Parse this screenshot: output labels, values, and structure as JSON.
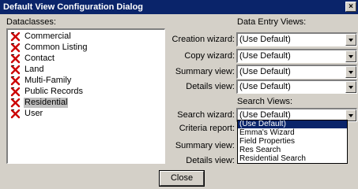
{
  "window": {
    "title": "Default View Configuration Dialog",
    "close_glyph": "×"
  },
  "dataclasses": {
    "label": "Dataclasses:",
    "items": [
      {
        "label": "Commercial",
        "selected": false
      },
      {
        "label": "Common Listing",
        "selected": false
      },
      {
        "label": "Contact",
        "selected": false
      },
      {
        "label": "Land",
        "selected": false
      },
      {
        "label": "Multi-Family",
        "selected": false
      },
      {
        "label": "Public Records",
        "selected": false
      },
      {
        "label": "Residential",
        "selected": true
      },
      {
        "label": "User",
        "selected": false
      }
    ],
    "icon": "red-x-icon"
  },
  "data_entry_views": {
    "heading": "Data Entry Views:",
    "creation_wizard": {
      "label": "Creation wizard:",
      "value": "(Use Default)"
    },
    "copy_wizard": {
      "label": "Copy wizard:",
      "value": "(Use Default)"
    },
    "summary_view": {
      "label": "Summary view:",
      "value": "(Use Default)"
    },
    "details_view": {
      "label": "Details view:",
      "value": "(Use Default)"
    }
  },
  "search_views": {
    "heading": "Search Views:",
    "search_wizard": {
      "label": "Search wizard:",
      "value": "(Use Default)"
    },
    "criteria_report": {
      "label": "Criteria report:"
    },
    "summary_view": {
      "label": "Summary view:"
    },
    "details_view": {
      "label": "Details view:"
    }
  },
  "dropdown_options": [
    {
      "label": "(Use Default)",
      "highlighted": true
    },
    {
      "label": "Emma's Wizard",
      "highlighted": false
    },
    {
      "label": "Field Properties",
      "highlighted": false
    },
    {
      "label": "Res Search",
      "highlighted": false
    },
    {
      "label": "Residential Search",
      "highlighted": false
    }
  ],
  "close_button": {
    "label": "Close"
  },
  "colors": {
    "titlebar": "#0a246a",
    "highlight": "#0a246a",
    "selected_item": "#c0c0c0",
    "icon": "#cc0000",
    "face": "#d4d0c8"
  }
}
